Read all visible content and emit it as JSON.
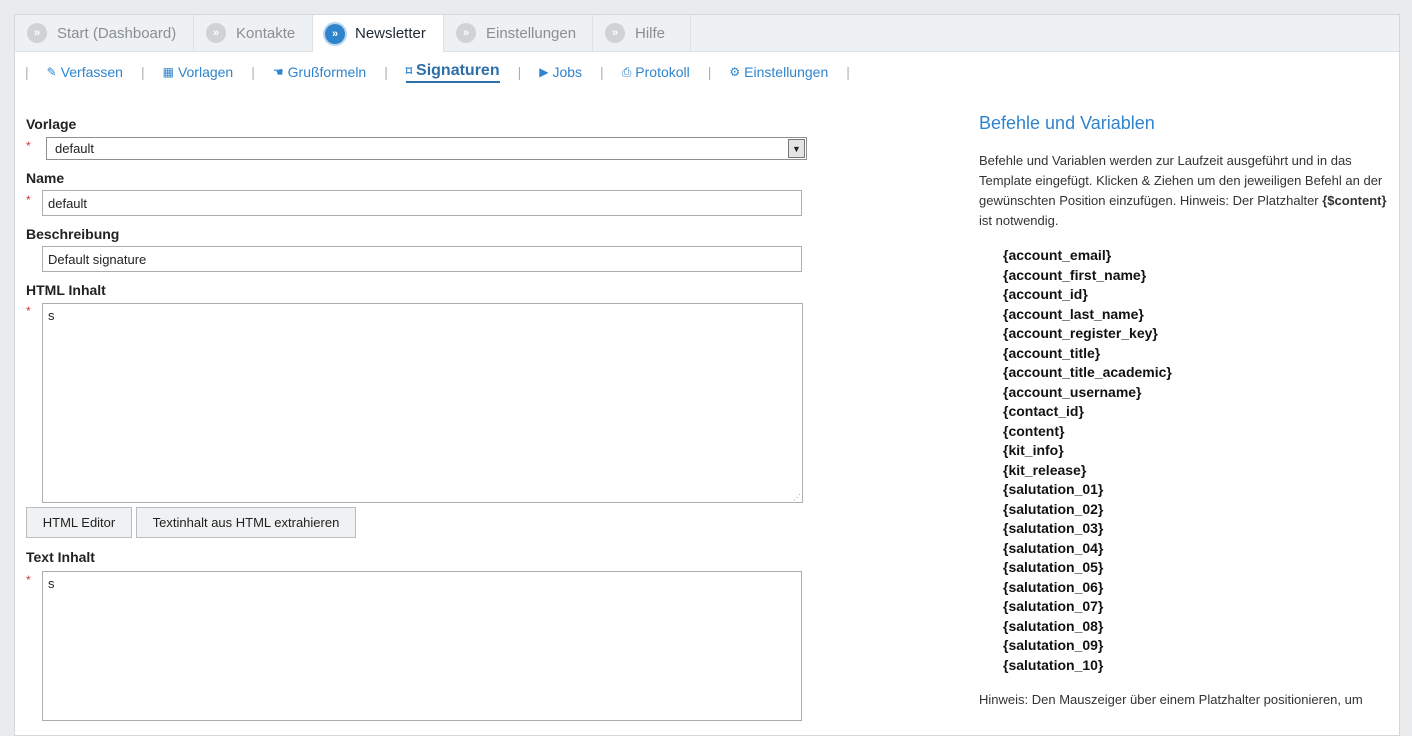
{
  "tabs": [
    {
      "label": "Start (Dashboard)",
      "active": false
    },
    {
      "label": "Kontakte",
      "active": false
    },
    {
      "label": "Newsletter",
      "active": true
    },
    {
      "label": "Einstellungen",
      "active": false
    },
    {
      "label": "Hilfe",
      "active": false
    }
  ],
  "subnav": [
    {
      "label": "Verfassen",
      "icon": "pencil-icon"
    },
    {
      "label": "Vorlagen",
      "icon": "template-icon"
    },
    {
      "label": "Grußformeln",
      "icon": "hand-icon"
    },
    {
      "label": "Signaturen",
      "icon": "bookmark-icon",
      "active": true
    },
    {
      "label": "Jobs",
      "icon": "play-icon"
    },
    {
      "label": "Protokoll",
      "icon": "printer-icon"
    },
    {
      "label": "Einstellungen",
      "icon": "gears-icon"
    }
  ],
  "form": {
    "vorlage_label": "Vorlage",
    "vorlage_value": "default",
    "name_label": "Name",
    "name_value": "default",
    "beschreibung_label": "Beschreibung",
    "beschreibung_value": "Default signature",
    "html_label": "HTML Inhalt",
    "html_value": "s",
    "html_editor_button": "HTML Editor",
    "extract_button": "Textinhalt aus HTML extrahieren",
    "text_label": "Text Inhalt",
    "text_value": "s",
    "required_mark": "*"
  },
  "sidebar": {
    "title": "Befehle und Variablen",
    "intro_text": "Befehle und Variablen werden zur Laufzeit ausgeführt und in das Template eingefügt. Klicken & Ziehen um den jeweiligen Befehl an der gewünschten Position einzufügen. Hinweis: Der Platzhalter ",
    "intro_bold": "{$content}",
    "intro_tail": " ist notwendig.",
    "variables": [
      "{account_email}",
      "{account_first_name}",
      "{account_id}",
      "{account_last_name}",
      "{account_register_key}",
      "{account_title}",
      "{account_title_academic}",
      "{account_username}",
      "{contact_id}",
      "{content}",
      "{kit_info}",
      "{kit_release}",
      "{salutation_01}",
      "{salutation_02}",
      "{salutation_03}",
      "{salutation_04}",
      "{salutation_05}",
      "{salutation_06}",
      "{salutation_07}",
      "{salutation_08}",
      "{salutation_09}",
      "{salutation_10}"
    ],
    "footer_text": "Hinweis: Den Mauszeiger über einem Platzhalter positionieren, um"
  },
  "colors": {
    "accent": "#2f84cc",
    "required": "#dd3333"
  }
}
